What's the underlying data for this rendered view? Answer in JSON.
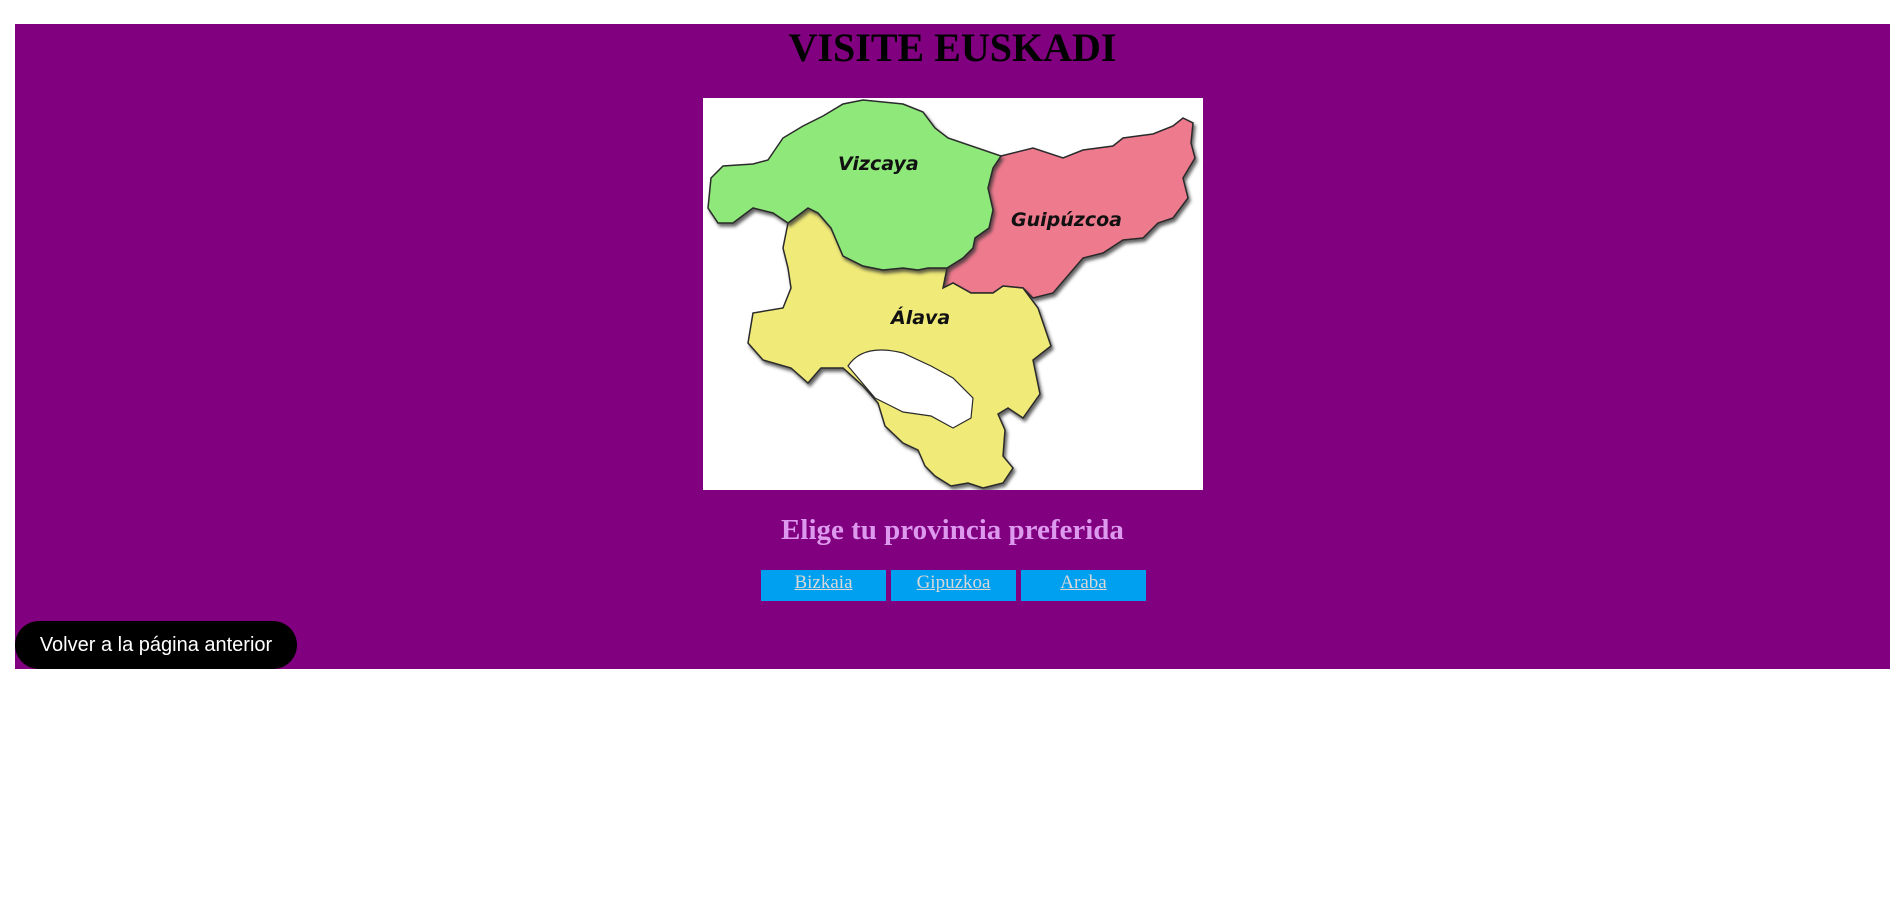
{
  "header": {
    "title": "VISITE EUSKADI"
  },
  "map": {
    "regions": [
      {
        "name": "Vizcaya",
        "color": "#8fe87a"
      },
      {
        "name": "Guipúzcoa",
        "color": "#ee7a8e"
      },
      {
        "name": "Álava",
        "color": "#f0ea78"
      }
    ]
  },
  "main": {
    "subtitle": "Elige tu provincia preferida"
  },
  "provinces": {
    "links": [
      "Bizkaia",
      "Gipuzkoa",
      "Araba"
    ]
  },
  "footer": {
    "back_label": "Volver a la página anterior"
  },
  "colors": {
    "page_background": "#800080",
    "province_button": "#00a0f0",
    "back_button": "#000000"
  }
}
